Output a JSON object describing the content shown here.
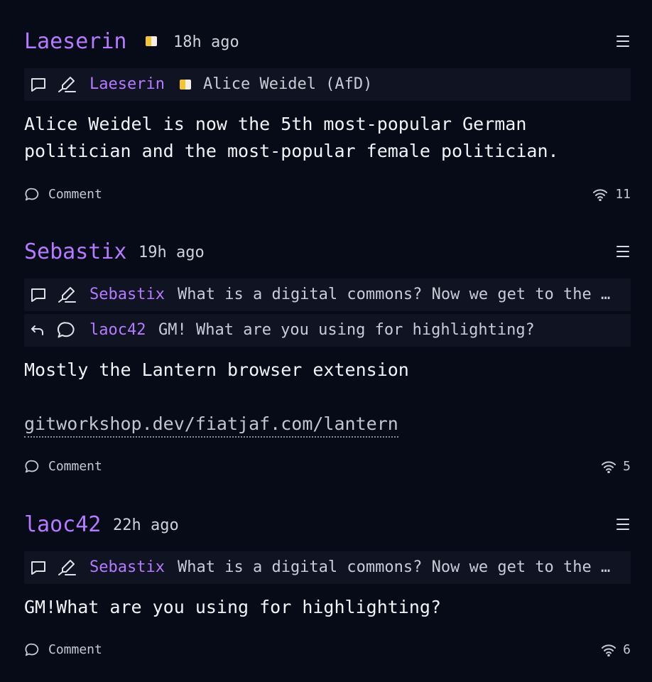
{
  "posts": [
    {
      "author": "Laeserin",
      "time": "18h ago",
      "quote": {
        "author": "Laeserin",
        "text": "Alice Weidel (AfD)"
      },
      "body": "Alice Weidel is now the 5th most-popular German\npolitician and the most-popular female politician.",
      "comment_label": "Comment",
      "relay_count": "11"
    },
    {
      "author": "Sebastix",
      "time": "19h ago",
      "quote": {
        "author": "Sebastix",
        "text": "What is a digital commons? Now we get to the …"
      },
      "reply": {
        "author": "laoc42",
        "text": "GM! What are you using for highlighting?"
      },
      "body": "Mostly the Lantern browser extension",
      "link": "gitworkshop.dev/fiatjaf.com/lantern",
      "comment_label": "Comment",
      "relay_count": "5"
    },
    {
      "author": "laoc42",
      "time": "22h ago",
      "quote": {
        "author": "Sebastix",
        "text": "What is a digital commons? Now we get to the …"
      },
      "body": "GM!What are you using for highlighting?",
      "comment_label": "Comment",
      "relay_count": "6"
    }
  ]
}
